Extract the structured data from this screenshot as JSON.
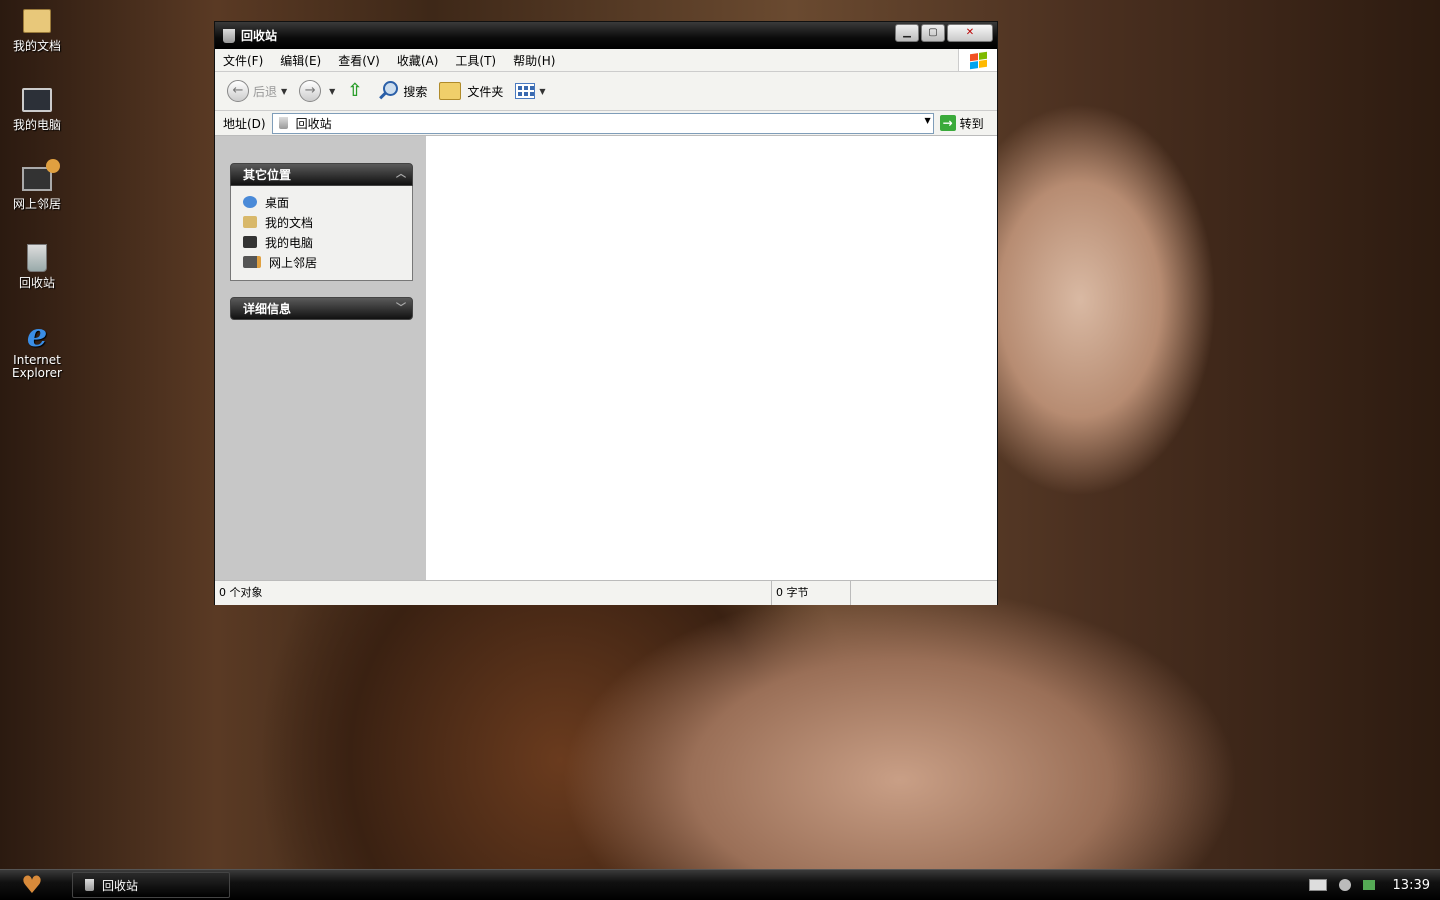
{
  "desktop": {
    "icons": [
      {
        "label": "我的文档"
      },
      {
        "label": "我的电脑"
      },
      {
        "label": "网上邻居"
      },
      {
        "label": "回收站"
      },
      {
        "label_line1": "Internet",
        "label_line2": "Explorer"
      }
    ]
  },
  "window": {
    "title": "回收站",
    "menu": [
      "文件(F)",
      "编辑(E)",
      "查看(V)",
      "收藏(A)",
      "工具(T)",
      "帮助(H)"
    ],
    "toolbar": {
      "back_label": "后退",
      "search_label": "搜索",
      "folders_label": "文件夹"
    },
    "address": {
      "label": "地址(D)",
      "value": "回收站",
      "go_label": "转到"
    },
    "taskpane": {
      "other_places": {
        "title": "其它位置",
        "items": [
          "桌面",
          "我的文档",
          "我的电脑",
          "网上邻居"
        ]
      },
      "details": {
        "title": "详细信息"
      }
    },
    "statusbar": {
      "objects": "0 个对象",
      "size": "0 字节"
    }
  },
  "taskbar": {
    "task_label": "回收站",
    "clock": "13:39"
  },
  "colors": {
    "titlebar": "#000000",
    "taskpane_bg": "#c7c7c7",
    "toolbar_bg": "#f3f3f0"
  }
}
